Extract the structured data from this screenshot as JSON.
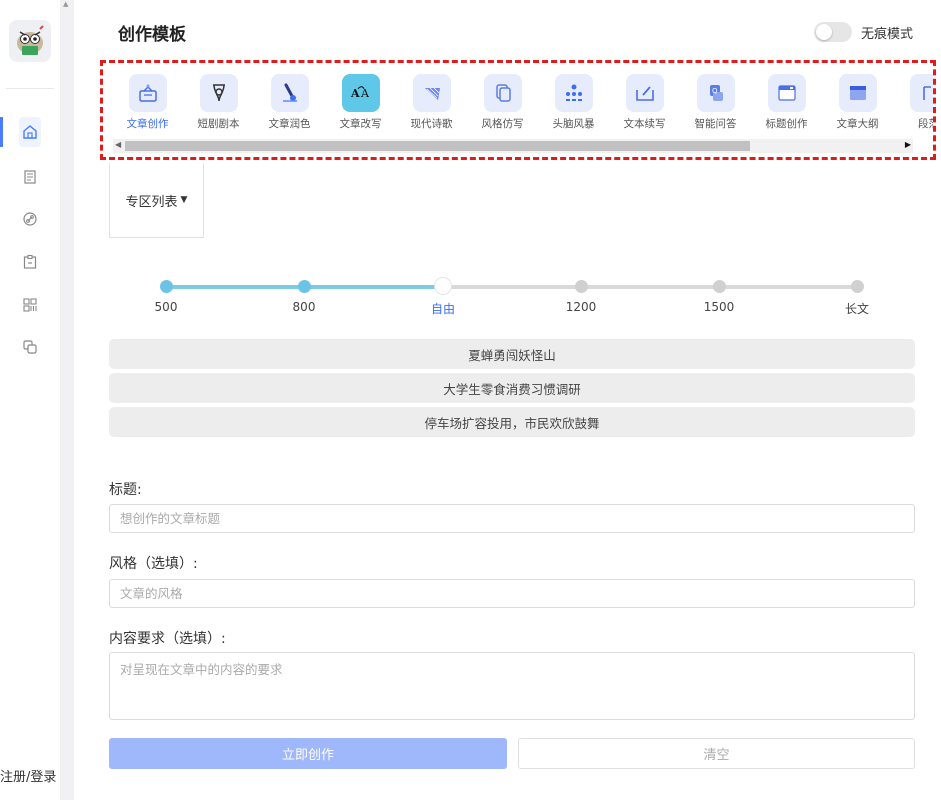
{
  "header": {
    "title": "创作模板",
    "incognito_label": "无痕模式",
    "incognito_on": false
  },
  "sidebar": {
    "login_label": "注册/登录",
    "items": [
      {
        "icon": "home-icon",
        "active": true
      },
      {
        "icon": "document-list-icon",
        "active": false
      },
      {
        "icon": "link-icon",
        "active": false
      },
      {
        "icon": "clipboard-icon",
        "active": false
      },
      {
        "icon": "grid-apps-icon",
        "active": false
      },
      {
        "icon": "copy-layers-icon",
        "active": false
      }
    ]
  },
  "templates": [
    {
      "label": "文章创作",
      "icon": "article-create-icon",
      "active": true
    },
    {
      "label": "短剧剧本",
      "icon": "pen-nib-icon",
      "active": false
    },
    {
      "label": "文章润色",
      "icon": "brush-icon",
      "active": false
    },
    {
      "label": "文章改写",
      "icon": "translate-icon",
      "active": false
    },
    {
      "label": "现代诗歌",
      "icon": "fan-icon",
      "active": false
    },
    {
      "label": "风格仿写",
      "icon": "copy-doc-icon",
      "active": false
    },
    {
      "label": "头脑风暴",
      "icon": "brainstorm-icon",
      "active": false
    },
    {
      "label": "文本续写",
      "icon": "continue-write-icon",
      "active": false
    },
    {
      "label": "智能问答",
      "icon": "qa-icon",
      "active": false
    },
    {
      "label": "标题创作",
      "icon": "title-window-icon",
      "active": false
    },
    {
      "label": "文章大纲",
      "icon": "outline-icon",
      "active": false
    },
    {
      "label": "段落",
      "icon": "paragraph-icon",
      "active": false
    }
  ],
  "zone_dropdown": {
    "label": "专区列表"
  },
  "length_slider": {
    "stops": [
      "500",
      "800",
      "自由",
      "1200",
      "1500",
      "长文"
    ],
    "selected_index": 2
  },
  "samples": [
    "夏蝉勇闯妖怪山",
    "大学生零食消费习惯调研",
    "停车场扩容投用，市民欢欣鼓舞"
  ],
  "form": {
    "title_label": "标题:",
    "title_placeholder": "想创作的文章标题",
    "style_label": "风格（选填）:",
    "style_placeholder": "文章的风格",
    "content_label": "内容要求（选填）:",
    "content_placeholder": "对呈现在文章中的内容的要求"
  },
  "actions": {
    "create_label": "立即创作",
    "clear_label": "清空"
  },
  "colors": {
    "accent": "#3b6ef5",
    "primary_button": "#9fb7fb",
    "highlight_border": "#e01b1b",
    "slider_fill": "#7ccbe6"
  }
}
